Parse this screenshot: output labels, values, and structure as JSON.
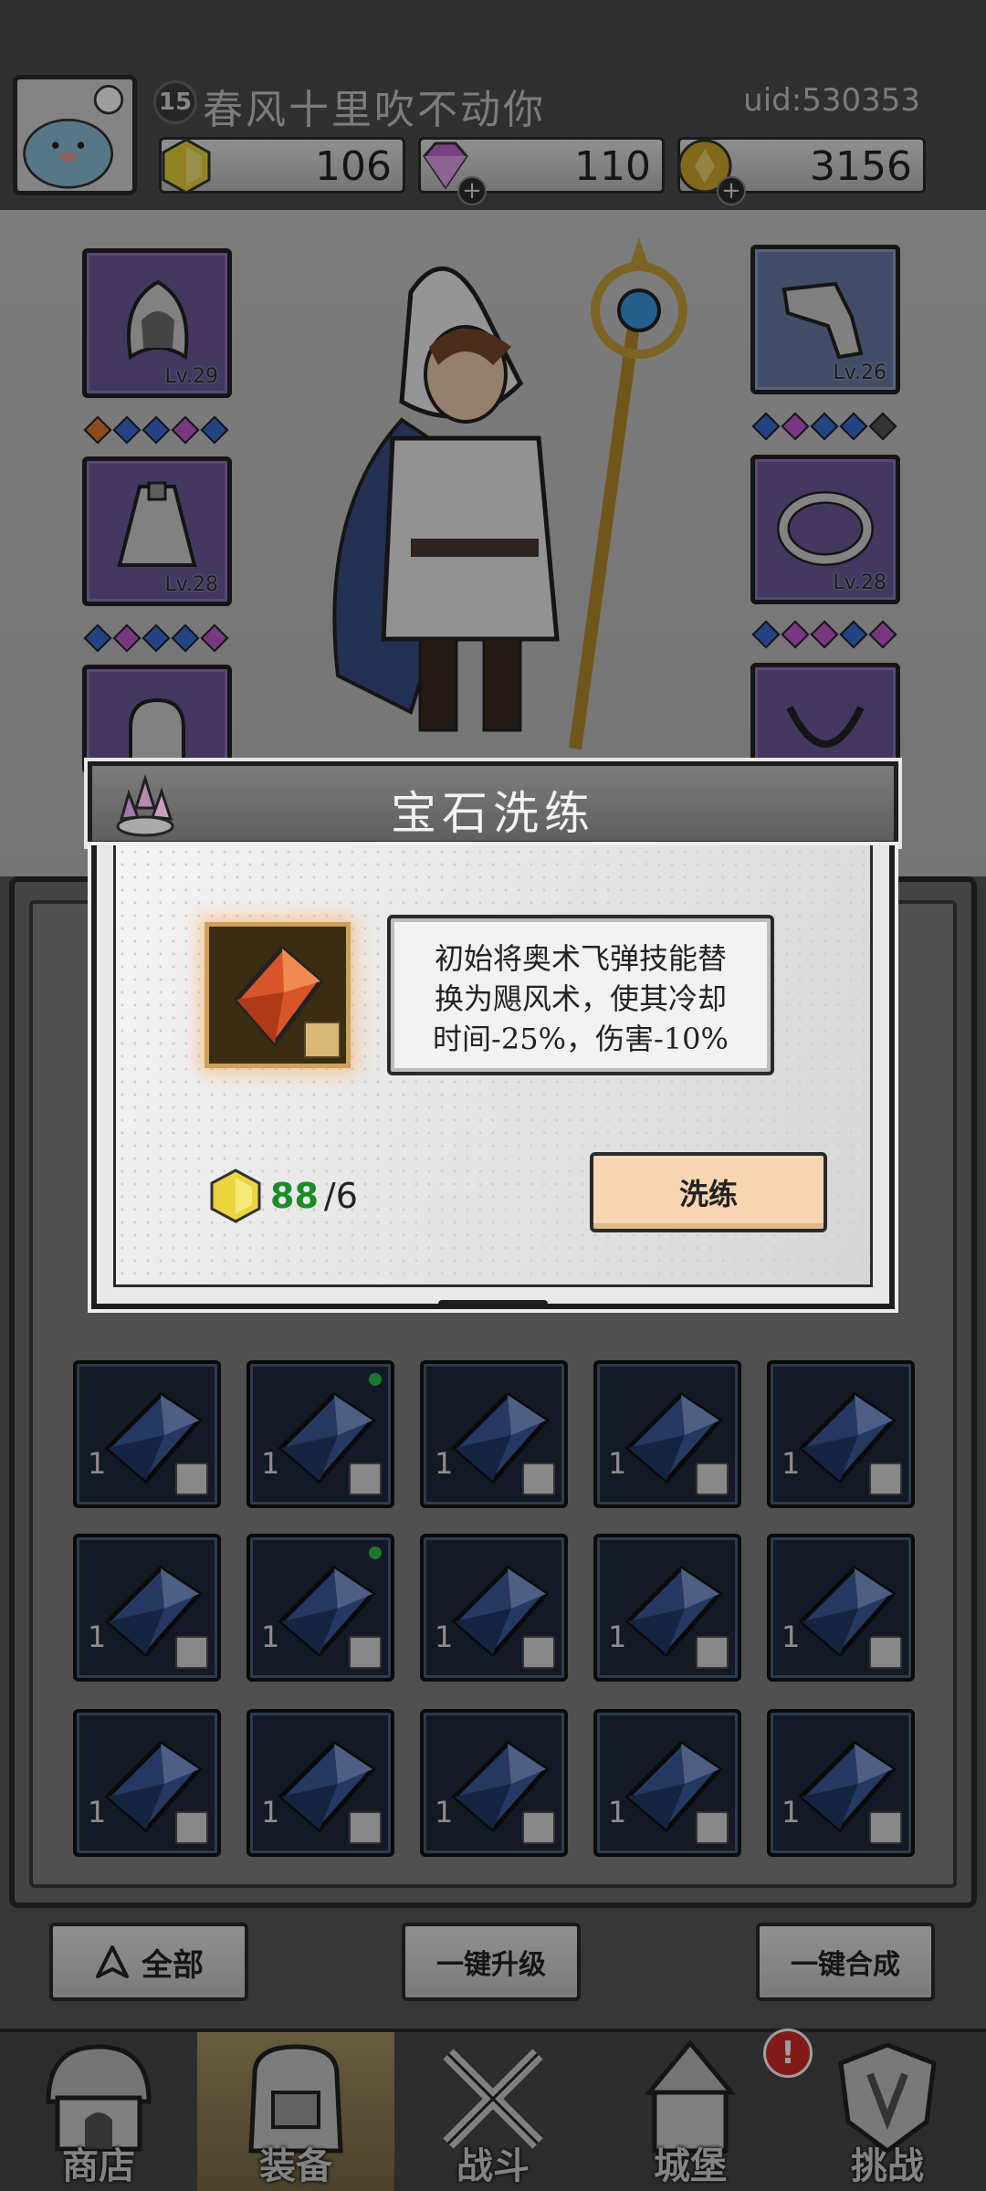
{
  "player": {
    "name": "春风十里吹不动你",
    "level": "15",
    "uid": "uid:530353"
  },
  "currencies": [
    {
      "name": "gold-gem",
      "value": "106",
      "color": "#e5d43a"
    },
    {
      "name": "diamond",
      "value": "110",
      "color": "#c66ad6"
    },
    {
      "name": "coin",
      "value": "3156",
      "color": "#d4aa2c"
    }
  ],
  "equipment": {
    "left": [
      {
        "slot": "hood",
        "level": "Lv.29"
      },
      {
        "slot": "cape",
        "level": "Lv.28"
      },
      {
        "slot": "pouch",
        "level": ""
      }
    ],
    "right": [
      {
        "slot": "gauntlet",
        "level": "Lv.26"
      },
      {
        "slot": "ring",
        "level": "Lv.28"
      },
      {
        "slot": "necklace",
        "level": ""
      }
    ]
  },
  "dialog": {
    "title": "宝石洗练",
    "description_line1": "初始将奥术飞弹技能替",
    "description_line2": "换为飓风术，使其冷却",
    "description_line3": "时间-25%，伤害-10%",
    "cost_have": "88",
    "cost_need": "/6",
    "refine_button": "洗练"
  },
  "inventory": {
    "rows": [
      [
        {
          "qty": "1",
          "dot": false
        },
        {
          "qty": "1",
          "dot": true
        },
        {
          "qty": "1",
          "dot": false
        },
        {
          "qty": "1",
          "dot": false
        },
        {
          "qty": "1",
          "dot": false
        }
      ],
      [
        {
          "qty": "1",
          "dot": false
        },
        {
          "qty": "1",
          "dot": true
        },
        {
          "qty": "1",
          "dot": false
        },
        {
          "qty": "1",
          "dot": false
        },
        {
          "qty": "1",
          "dot": false
        }
      ],
      [
        {
          "qty": "1",
          "dot": false
        },
        {
          "qty": "1",
          "dot": false
        },
        {
          "qty": "1",
          "dot": false
        },
        {
          "qty": "1",
          "dot": false
        },
        {
          "qty": "1",
          "dot": false
        }
      ]
    ]
  },
  "actions": {
    "filter_all": "全部",
    "upgrade_all": "一键升级",
    "merge_all": "一键合成"
  },
  "nav": {
    "shop": "商店",
    "equipment": "装备",
    "battle": "战斗",
    "castle": "城堡",
    "challenge": "挑战",
    "castle_alert": "!"
  }
}
